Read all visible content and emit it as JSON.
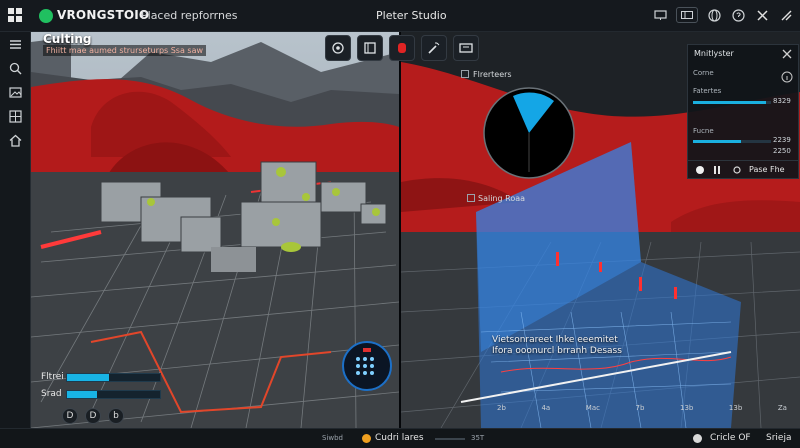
{
  "titlebar": {
    "brand": "VRONGSTOIO",
    "project": "Placed repforrnes",
    "window_title": "Pleter Studio",
    "icons": [
      "monitor-icon",
      "panel-icon",
      "globe-icon",
      "help-icon",
      "close-icon",
      "minimize-icon"
    ]
  },
  "left_toolbar": {
    "icons": [
      "menu-icon",
      "search-icon",
      "image-icon",
      "layers-icon",
      "home-icon"
    ]
  },
  "left_viewport": {
    "title": "Culting",
    "subtitle": "Fhiitt mae aumed strurseturps Ssa saw",
    "tools": [
      "brush-icon",
      "frame-icon",
      "record-icon",
      "wand-icon",
      "monitor-icon"
    ],
    "stats": [
      {
        "label": "Fltrei",
        "fill": 0.45
      },
      {
        "label": "Srad",
        "fill": 0.32
      }
    ],
    "buttons": [
      "D",
      "D",
      "b"
    ]
  },
  "right_viewport": {
    "checkbox_label": "Flrerteers",
    "node_label": "Saling Roaa",
    "caption": "Vietsonrareet Ihke eeemitet Ifora ooonurcl brranh Desass",
    "axis_ticks": [
      "2b",
      "4a",
      "Mac",
      "7b",
      "13b",
      "13b",
      "Za"
    ]
  },
  "panel": {
    "title": "Mnitlyster",
    "rows": [
      {
        "label": "Corne",
        "value": "",
        "fill": 0
      },
      {
        "label": "Fatertes",
        "value": "8329",
        "fill": 0.94
      },
      {
        "label": "Fucne",
        "value": "2239",
        "fill": 0.62
      }
    ],
    "extra_value": "2250",
    "footer_link": "Pase Fhe"
  },
  "statusbar": {
    "left": "Siwbd",
    "center": "Cudri lares",
    "right_value": "35T",
    "toggle_label": "Cricle OF",
    "end_label": "Srieja"
  }
}
